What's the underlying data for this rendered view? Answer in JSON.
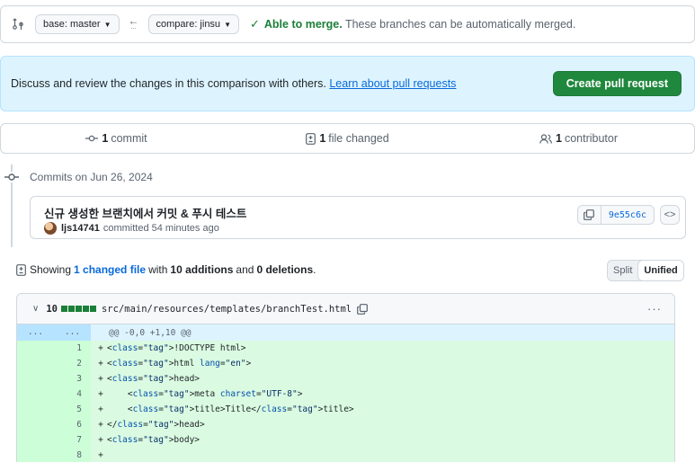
{
  "compare": {
    "base_label": "base: master",
    "compare_label": "compare: jinsu",
    "merge_status_strong": "Able to merge.",
    "merge_status_rest": " These branches can be automatically merged."
  },
  "discuss": {
    "text": "Discuss and review the changes in this comparison with others. ",
    "link": "Learn about pull requests",
    "button": "Create pull request"
  },
  "stats": {
    "commits_count": "1",
    "commits_label": "commit",
    "files_count": "1",
    "files_label": "file changed",
    "contributors_count": "1",
    "contributors_label": "contributor"
  },
  "timeline": {
    "date_heading": "Commits on Jun 26, 2024"
  },
  "commit": {
    "title": "신규 생성한 브랜치에서 커밋 & 푸시 테스트",
    "author": "ljs14741",
    "meta": "committed 54 minutes ago",
    "sha": "9e55c6c"
  },
  "showing": {
    "prefix": "Showing",
    "files_link": "1 changed file",
    "with": "with",
    "additions": "10 additions",
    "and": "and",
    "deletions": "0 deletions",
    "suffix": "."
  },
  "view_toggle": {
    "split": "Split",
    "unified": "Unified"
  },
  "diff": {
    "count": "10",
    "path": "src/main/resources/templates/branchTest.html",
    "hunk_old": "...",
    "hunk_new": "...",
    "hunk_text": "@@ -0,0 +1,10 @@",
    "lines": [
      {
        "n": "1",
        "sign": "+",
        "code": "<!DOCTYPE html>"
      },
      {
        "n": "2",
        "sign": "+",
        "code": "<html lang=\"en\">"
      },
      {
        "n": "3",
        "sign": "+",
        "code": "<head>"
      },
      {
        "n": "4",
        "sign": "+",
        "code": "    <meta charset=\"UTF-8\">"
      },
      {
        "n": "5",
        "sign": "+",
        "code": "    <title>Title</title>"
      },
      {
        "n": "6",
        "sign": "+",
        "code": "</head>"
      },
      {
        "n": "7",
        "sign": "+",
        "code": "<body>"
      },
      {
        "n": "8",
        "sign": "+",
        "code": ""
      }
    ]
  },
  "colors": {
    "merge_green": "#1a7f37",
    "link_blue": "#0969da",
    "addition_bg": "#dafbe1",
    "hunk_bg": "#ddf4ff"
  }
}
